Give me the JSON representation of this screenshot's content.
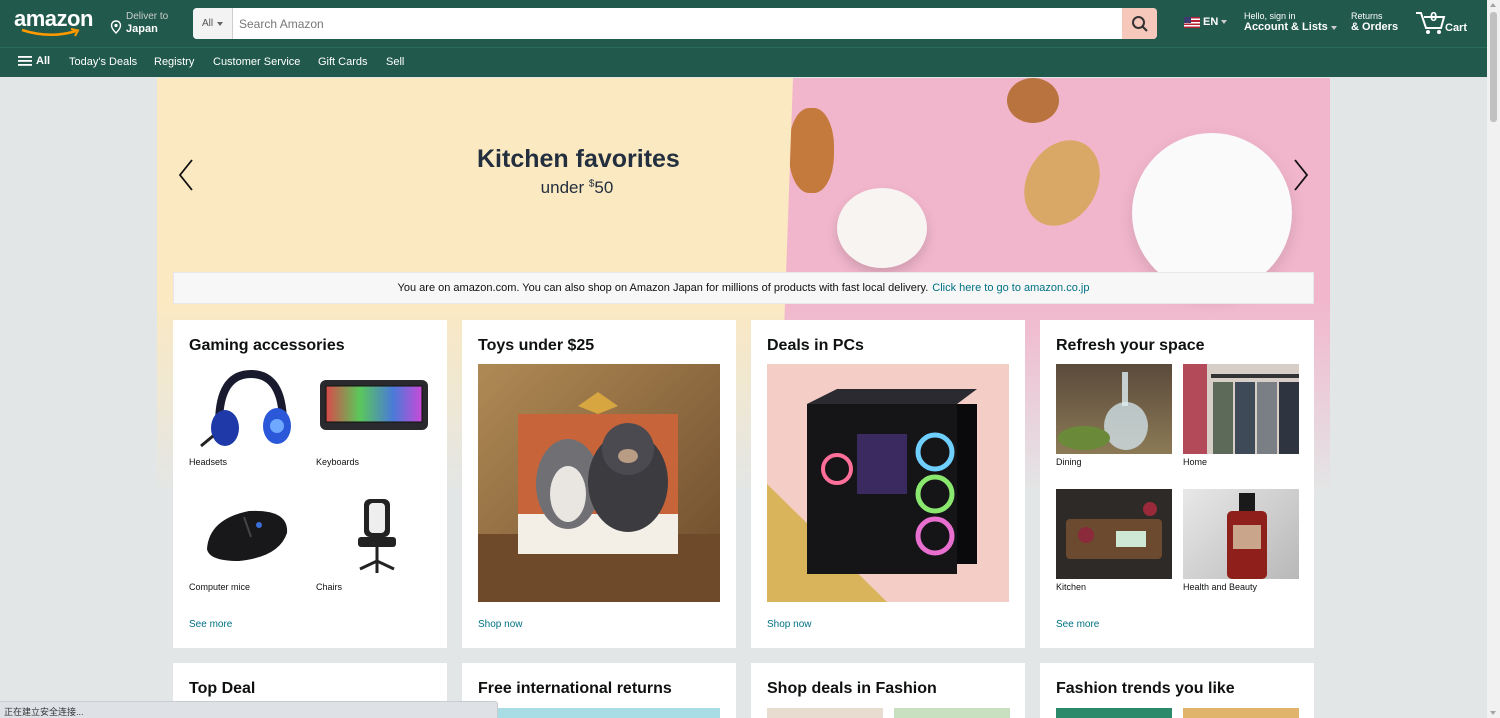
{
  "header": {
    "logo": "amazon",
    "deliver_line1": "Deliver to",
    "deliver_line2": "Japan",
    "search_category": "All",
    "search_placeholder": "Search Amazon",
    "language": "EN",
    "account_line1": "Hello, sign in",
    "account_line2": "Account & Lists",
    "returns_line1": "Returns",
    "returns_line2": "& Orders",
    "cart_count": "0",
    "cart_label": "Cart"
  },
  "subnav": {
    "all": "All",
    "items": [
      "Today's Deals",
      "Registry",
      "Customer Service",
      "Gift Cards",
      "Sell"
    ]
  },
  "hero": {
    "title": "Kitchen favorites",
    "subtitle_prefix": "under ",
    "subtitle_currency": "$",
    "subtitle_amount": "50"
  },
  "notice": {
    "text": "You are on amazon.com. You can also shop on Amazon Japan for millions of products with fast local delivery.",
    "link": "Click here to go to amazon.co.jp"
  },
  "cards": [
    {
      "title": "Gaming accessories",
      "tiles": [
        "Headsets",
        "Keyboards",
        "Computer mice",
        "Chairs"
      ],
      "link": "See more"
    },
    {
      "title": "Toys under $25",
      "link": "Shop now"
    },
    {
      "title": "Deals in PCs",
      "link": "Shop now"
    },
    {
      "title": "Refresh your space",
      "tiles": [
        "Dining",
        "Home",
        "Kitchen",
        "Health and Beauty"
      ],
      "link": "See more"
    }
  ],
  "cards_row2": [
    "Top Deal",
    "Free international returns",
    "Shop deals in Fashion",
    "Fashion trends you like"
  ],
  "status_bar": "正在建立安全连接...",
  "colors": {
    "nav_bg": "#215a4c",
    "search_button": "#f6c7bb",
    "link": "#007185",
    "page_bg": "#e3e6e6"
  },
  "icons": [
    "location-pin-icon",
    "search-icon",
    "caret-down-icon",
    "us-flag-icon",
    "cart-icon",
    "hamburger-icon",
    "chevron-left-icon",
    "chevron-right-icon"
  ]
}
